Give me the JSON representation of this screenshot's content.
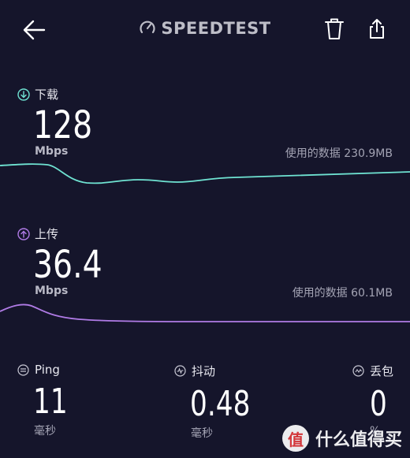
{
  "header": {
    "brand": "SPEEDTEST",
    "back_icon": "arrow-left-icon",
    "delete_icon": "trash-icon",
    "share_icon": "share-icon"
  },
  "download": {
    "label": "下载",
    "value": "128",
    "unit": "Mbps",
    "data_used": "使用的数据 230.9MB",
    "color": "#6fe3d2"
  },
  "upload": {
    "label": "上传",
    "value": "36.4",
    "unit": "Mbps",
    "data_used": "使用的数据 60.1MB",
    "color": "#b07be6"
  },
  "stats": {
    "ping": {
      "label": "Ping",
      "value": "11",
      "unit": "毫秒"
    },
    "jitter": {
      "label": "抖动",
      "value": "0.48",
      "unit": "毫秒"
    },
    "loss": {
      "label": "丢包",
      "value": "0",
      "unit": "%"
    }
  },
  "watermark": {
    "logo_text": "值",
    "text": "什么值得买"
  }
}
